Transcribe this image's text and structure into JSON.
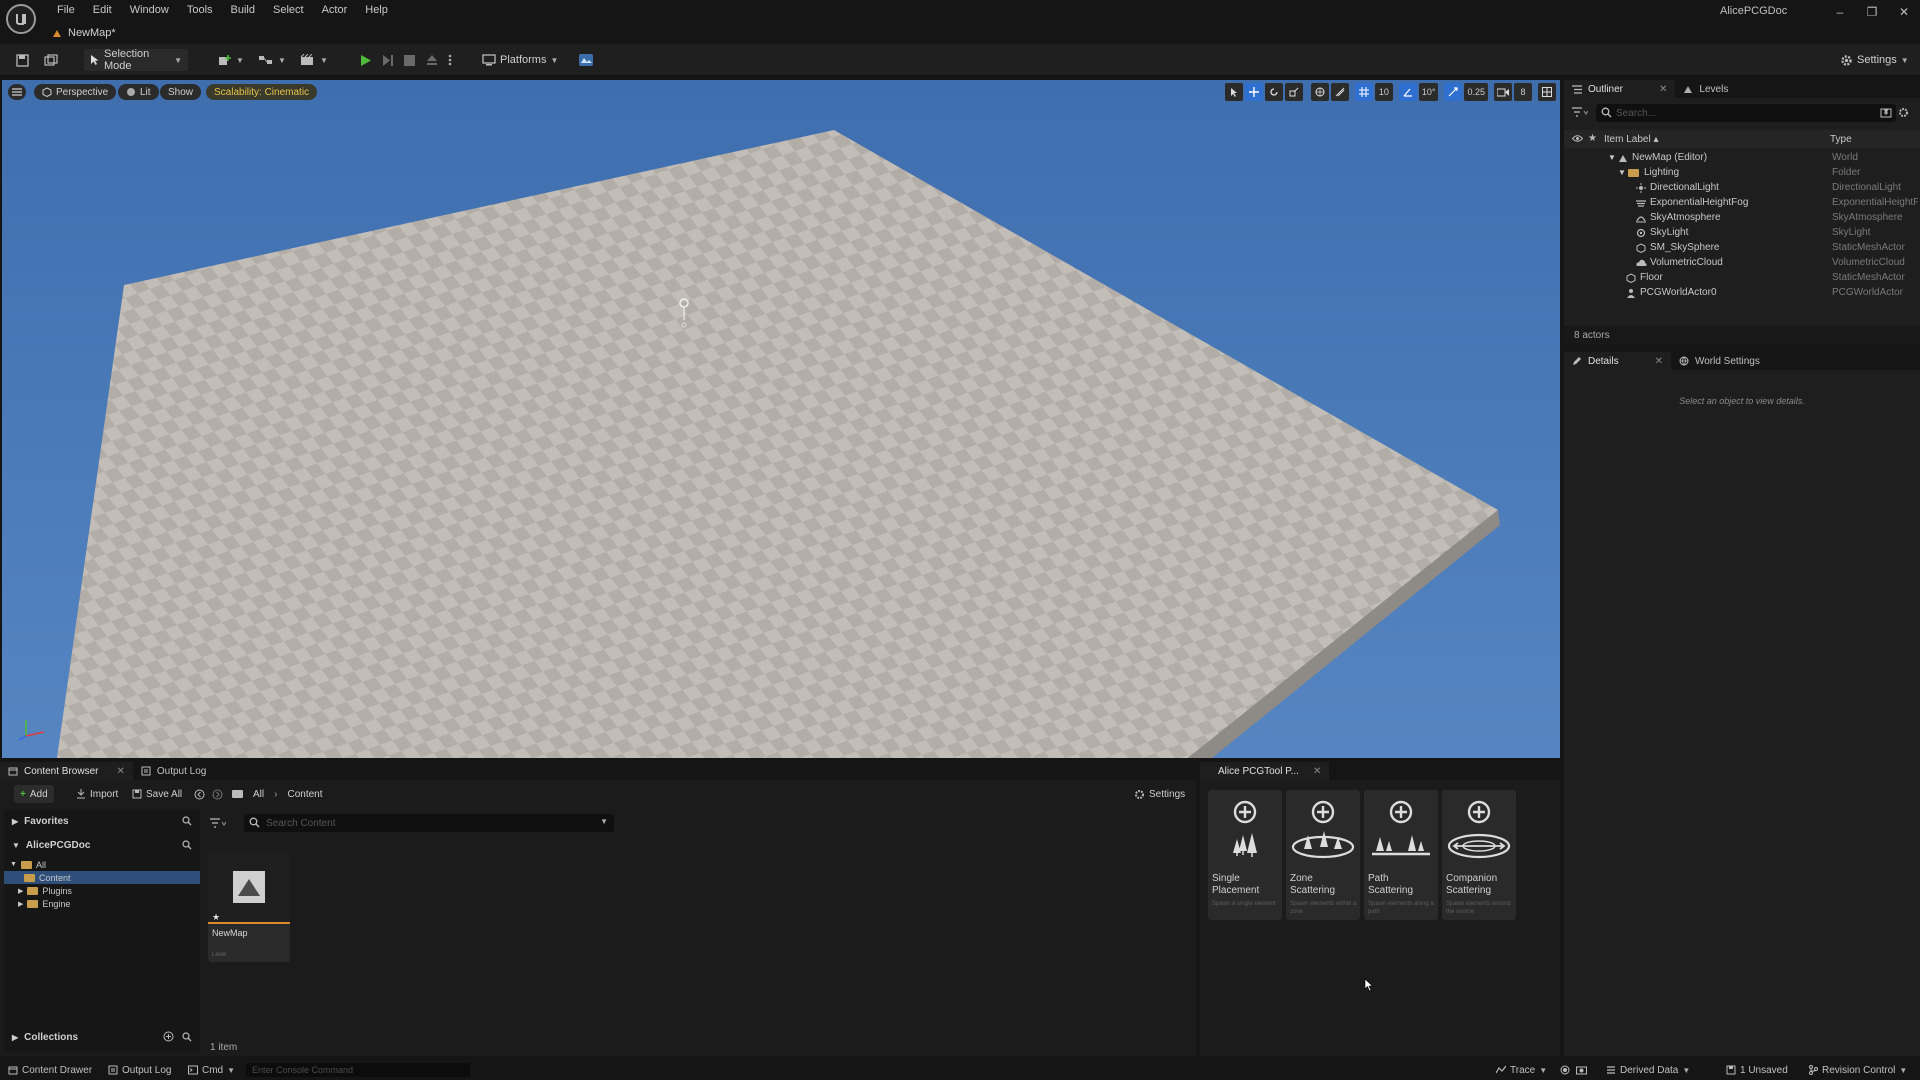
{
  "menu": [
    "File",
    "Edit",
    "Window",
    "Tools",
    "Build",
    "Select",
    "Actor",
    "Help"
  ],
  "doc_tab": "NewMap*",
  "project_name": "AlicePCGDoc",
  "window_controls": {
    "minimize": "–",
    "restore": "❐",
    "close": "✕"
  },
  "toolbar": {
    "selection_mode": "Selection Mode",
    "platforms": "Platforms",
    "settings": "Settings"
  },
  "viewport": {
    "perspective": "Perspective",
    "lit": "Lit",
    "show": "Show",
    "scalability": "Scalability: Cinematic",
    "grid_snap": "10",
    "rot_snap": "10°",
    "scale_snap": "0.25",
    "camera_speed": "8"
  },
  "outliner": {
    "tab": "Outliner",
    "tab2": "Levels",
    "search_placeholder": "Search...",
    "col_label": "Item Label ▴",
    "col_type": "Type",
    "items": [
      {
        "label": "NewMap (Editor)",
        "type": "World"
      },
      {
        "label": "Lighting",
        "type": "Folder"
      },
      {
        "label": "DirectionalLight",
        "type": "DirectionalLight"
      },
      {
        "label": "ExponentialHeightFog",
        "type": "ExponentialHeightFog"
      },
      {
        "label": "SkyAtmosphere",
        "type": "SkyAtmosphere"
      },
      {
        "label": "SkyLight",
        "type": "SkyLight"
      },
      {
        "label": "SM_SkySphere",
        "type": "StaticMeshActor"
      },
      {
        "label": "VolumetricCloud",
        "type": "VolumetricCloud"
      },
      {
        "label": "Floor",
        "type": "StaticMeshActor"
      },
      {
        "label": "PCGWorldActor0",
        "type": "PCGWorldActor"
      }
    ],
    "count": "8 actors"
  },
  "details": {
    "tab": "Details",
    "tab2": "World Settings",
    "empty": "Select an object to view details."
  },
  "content_browser": {
    "tab": "Content Browser",
    "tab2": "Output Log",
    "add": "Add",
    "import": "Import",
    "save_all": "Save All",
    "path_all": "All",
    "path_content": "Content",
    "settings": "Settings",
    "favorites": "Favorites",
    "project": "AlicePCGDoc",
    "folders": [
      "All",
      "Content",
      "Plugins",
      "Engine"
    ],
    "collections": "Collections",
    "search_placeholder": "Search Content",
    "asset_name": "NewMap",
    "asset_type": "Level",
    "item_count": "1 item"
  },
  "pcg_panel": {
    "tab": "Alice PCGTool P...",
    "cards": [
      {
        "title": "Single Placement",
        "desc": "Spawn a single element"
      },
      {
        "title": "Zone Scattering",
        "desc": "Spawn elements within a zone"
      },
      {
        "title": "Path Scattering",
        "desc": "Spawn elements along a path"
      },
      {
        "title": "Companion Scattering",
        "desc": "Spawn elements around the source"
      }
    ]
  },
  "statusbar": {
    "content_drawer": "Content Drawer",
    "output_log": "Output Log",
    "cmd": "Cmd",
    "console_placeholder": "Enter Console Command",
    "trace": "Trace",
    "derived_data": "Derived Data",
    "unsaved": "1 Unsaved",
    "revision_control": "Revision Control"
  },
  "colors": {
    "accent": "#2e6fd0",
    "sky": "#4a78b7",
    "play": "#4fbb3a",
    "folder": "#c79c4a",
    "scalability": "#e6c34c"
  }
}
